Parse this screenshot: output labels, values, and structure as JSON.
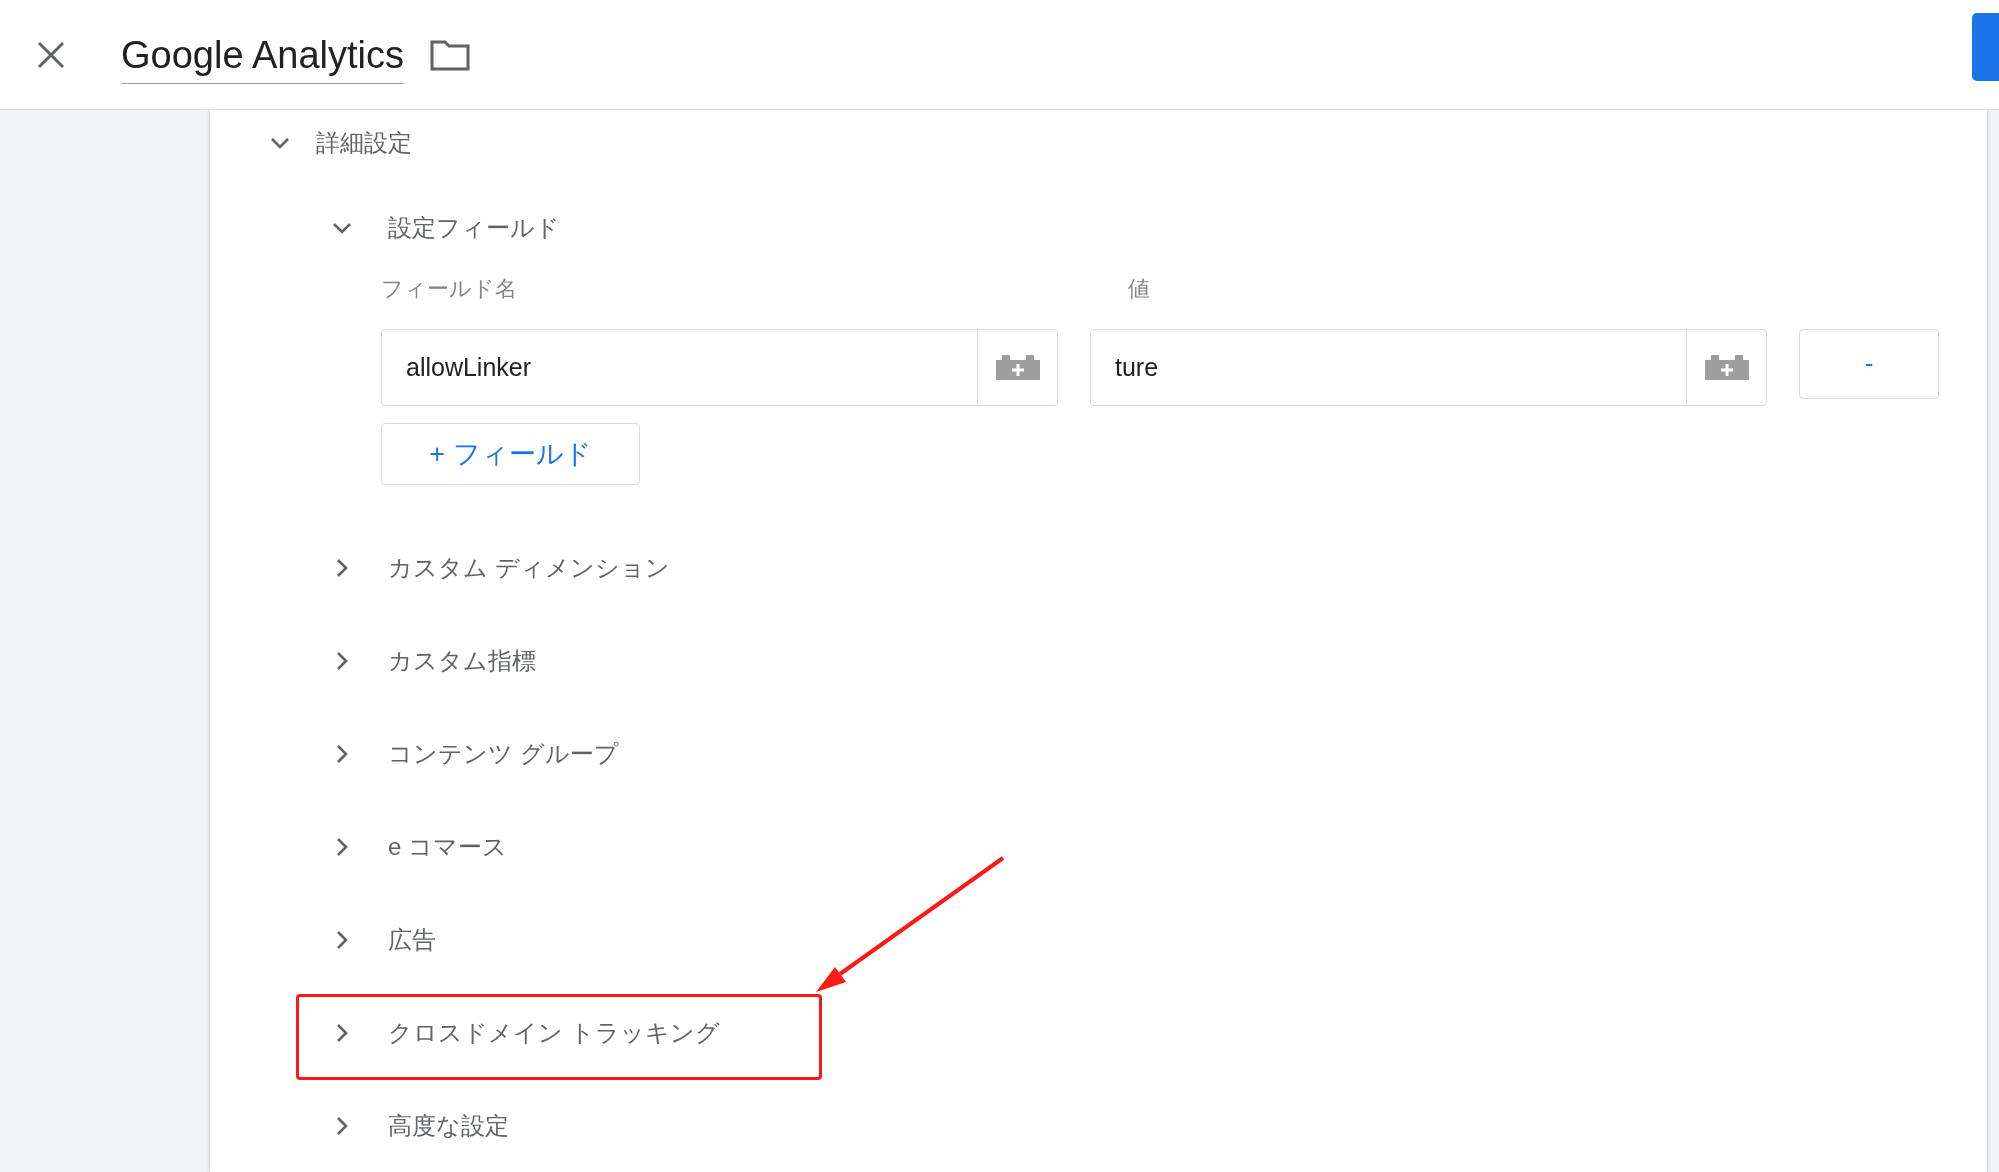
{
  "header": {
    "title": "Google Analytics"
  },
  "section": {
    "label": "詳細設定",
    "expanded": true,
    "fields_section": {
      "label": "設定フィールド",
      "expanded": true,
      "columns": [
        "フィールド名",
        "値"
      ],
      "rows": [
        {
          "name": "allowLinker",
          "value": "ture",
          "remove_label": "-"
        }
      ],
      "add_button": "+ フィールド"
    },
    "items": [
      {
        "label": "カスタム ディメンション",
        "expanded": false,
        "highlighted": false
      },
      {
        "label": "カスタム指標",
        "expanded": false,
        "highlighted": false
      },
      {
        "label": "コンテンツ グループ",
        "expanded": false,
        "highlighted": false
      },
      {
        "label": "e コマース",
        "expanded": false,
        "highlighted": false
      },
      {
        "label": "広告",
        "expanded": false,
        "highlighted": false
      },
      {
        "label": "クロスドメイン トラッキング",
        "expanded": false,
        "highlighted": true
      },
      {
        "label": "高度な設定",
        "expanded": false,
        "highlighted": false
      }
    ]
  }
}
